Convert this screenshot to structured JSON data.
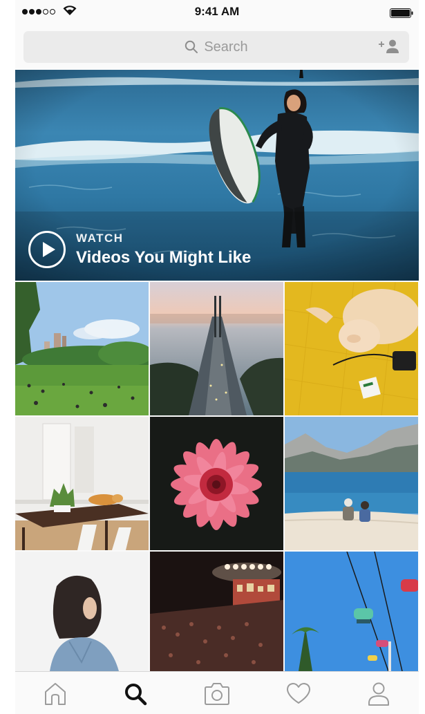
{
  "status_bar": {
    "time": "9:41 AM",
    "signal_bars_filled": 3,
    "signal_bars_total": 5,
    "wifi_icon": "wifi-icon",
    "battery_icon": "battery-icon"
  },
  "search": {
    "placeholder": "Search",
    "search_icon": "search-icon",
    "add_user_icon": "add-person-icon"
  },
  "hero": {
    "kicker": "WATCH",
    "title": "Videos You Might Like",
    "play_icon": "play-circle-icon"
  },
  "grid": {
    "tiles": [
      {
        "subject": "park"
      },
      {
        "subject": "bridge"
      },
      {
        "subject": "cat"
      },
      {
        "subject": "dining-room"
      },
      {
        "subject": "flower"
      },
      {
        "subject": "lake"
      },
      {
        "subject": "woman-portrait"
      },
      {
        "subject": "concert"
      },
      {
        "subject": "sky-ride"
      }
    ]
  },
  "tab_bar": {
    "tabs": [
      {
        "name": "home",
        "icon": "home-icon",
        "active": false
      },
      {
        "name": "search",
        "icon": "search-icon",
        "active": true
      },
      {
        "name": "camera",
        "icon": "camera-icon",
        "active": false
      },
      {
        "name": "activity",
        "icon": "heart-icon",
        "active": false
      },
      {
        "name": "profile",
        "icon": "person-icon",
        "active": false
      }
    ]
  },
  "colors": {
    "background": "#fafafa",
    "search_bg": "#ebebeb",
    "placeholder": "#9a9a9a",
    "active_icon": "#111111",
    "inactive_icon": "#9b9b9b"
  }
}
